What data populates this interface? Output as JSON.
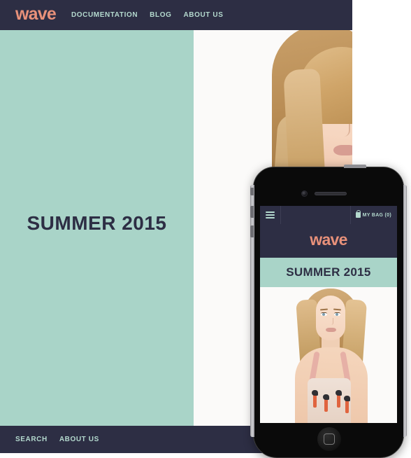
{
  "desktop": {
    "navbar": {
      "logo": "wave",
      "links": [
        "DOCUMENTATION",
        "BLOG",
        "ABOUT US"
      ]
    },
    "hero": {
      "title": "SUMMER 2015",
      "photo_alt": "blonde model in pink strap top"
    },
    "footer": {
      "links": [
        "SEARCH",
        "ABOUT US"
      ]
    }
  },
  "phone": {
    "topbar": {
      "menu_icon": "hamburger-icon",
      "bag_icon": "shopping-bag-icon",
      "bag_label": "MY BAG (0)"
    },
    "logo": "wave",
    "hero_title": "SUMMER 2015",
    "photo_alt": "blonde model in flamingo print crop top",
    "hardware": {
      "camera": "front-camera",
      "speaker": "earpiece-speaker",
      "home_button": "home-button",
      "power_button": "power-button",
      "volume_up": "volume-up-button",
      "volume_down": "volume-down-button",
      "silent_switch": "silent-switch"
    }
  },
  "colors": {
    "navy": "#2d2e44",
    "mint": "#a9d4c8",
    "coral": "#e8917a",
    "nav_text": "#b4d9ce",
    "page_bg": "#ffffff"
  }
}
